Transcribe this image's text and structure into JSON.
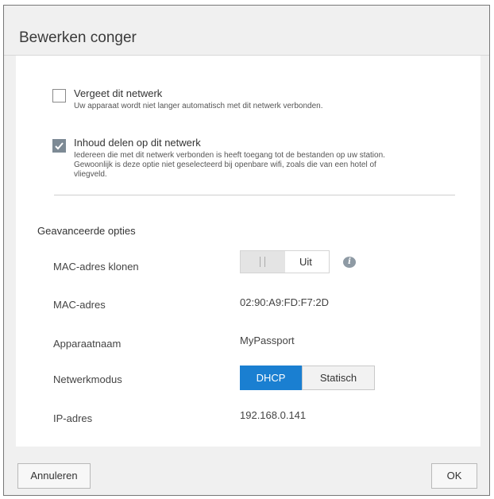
{
  "dialog": {
    "title": "Bewerken conger"
  },
  "options": {
    "forget": {
      "label": "Vergeet dit netwerk",
      "description": "Uw apparaat wordt niet langer automatisch met dit netwerk verbonden.",
      "checked": false
    },
    "share": {
      "label": "Inhoud delen op dit netwerk",
      "description_lines": [
        "Iedereen die met dit netwerk verbonden is heeft toegang tot de bestanden op uw station.",
        "Gewoonlijk is deze optie niet geselecteerd bij openbare wifi, zoals die van een hotel of",
        "vliegveld."
      ],
      "checked": true
    }
  },
  "advanced": {
    "heading": "Geavanceerde opties",
    "mac_clone": {
      "label": "MAC-adres klonen",
      "toggle_text": "Uit",
      "info_icon": "info-icon"
    },
    "mac_address": {
      "label": "MAC-adres",
      "value": "02:90:A9:FD:F7:2D"
    },
    "device_name": {
      "label": "Apparaatnaam",
      "value": "MyPassport"
    },
    "network_mode": {
      "label": "Netwerkmodus",
      "options": [
        "DHCP",
        "Statisch"
      ],
      "selected": "DHCP"
    },
    "ip_address": {
      "label": "IP-adres",
      "value": "192.168.0.141"
    }
  },
  "footer": {
    "cancel_label": "Annuleren",
    "ok_label": "OK"
  },
  "colors": {
    "accent": "#1a7fd1",
    "checkbox_checked": "#7d8a95"
  }
}
